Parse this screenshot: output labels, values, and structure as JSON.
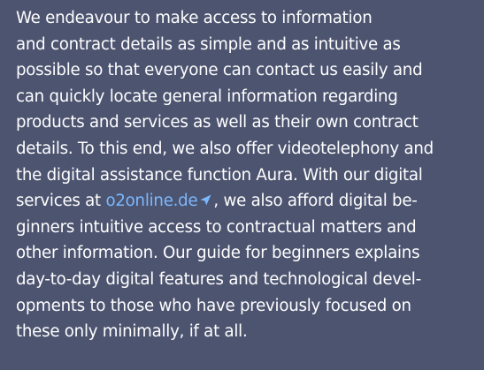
{
  "paragraph": {
    "lines": [
      "We endeavour to make access to information",
      "and contract details as simple and as intuitive as",
      "possible so that everyone can contact us easily and",
      "can quickly locate general information regarding",
      "products and services as well as their own contract",
      "details. To this end, we also offer videotelephony and",
      "the digital assistance function Aura. With our digital"
    ],
    "line8_before": "services at ",
    "link_text": "o2online.de",
    "link_icon": "external-link-icon",
    "line8_after": ", we also afford digital be-",
    "lines_after": [
      "ginners intuitive access to contractual matters and",
      "other information. Our guide for beginners explains",
      "day-to-day digital features and technological devel-",
      "opments to those who have previously focused on",
      "these only minimally, if at all."
    ]
  },
  "colors": {
    "background": "#4d5470",
    "text": "#ffffff",
    "link": "#7bb8ff"
  }
}
